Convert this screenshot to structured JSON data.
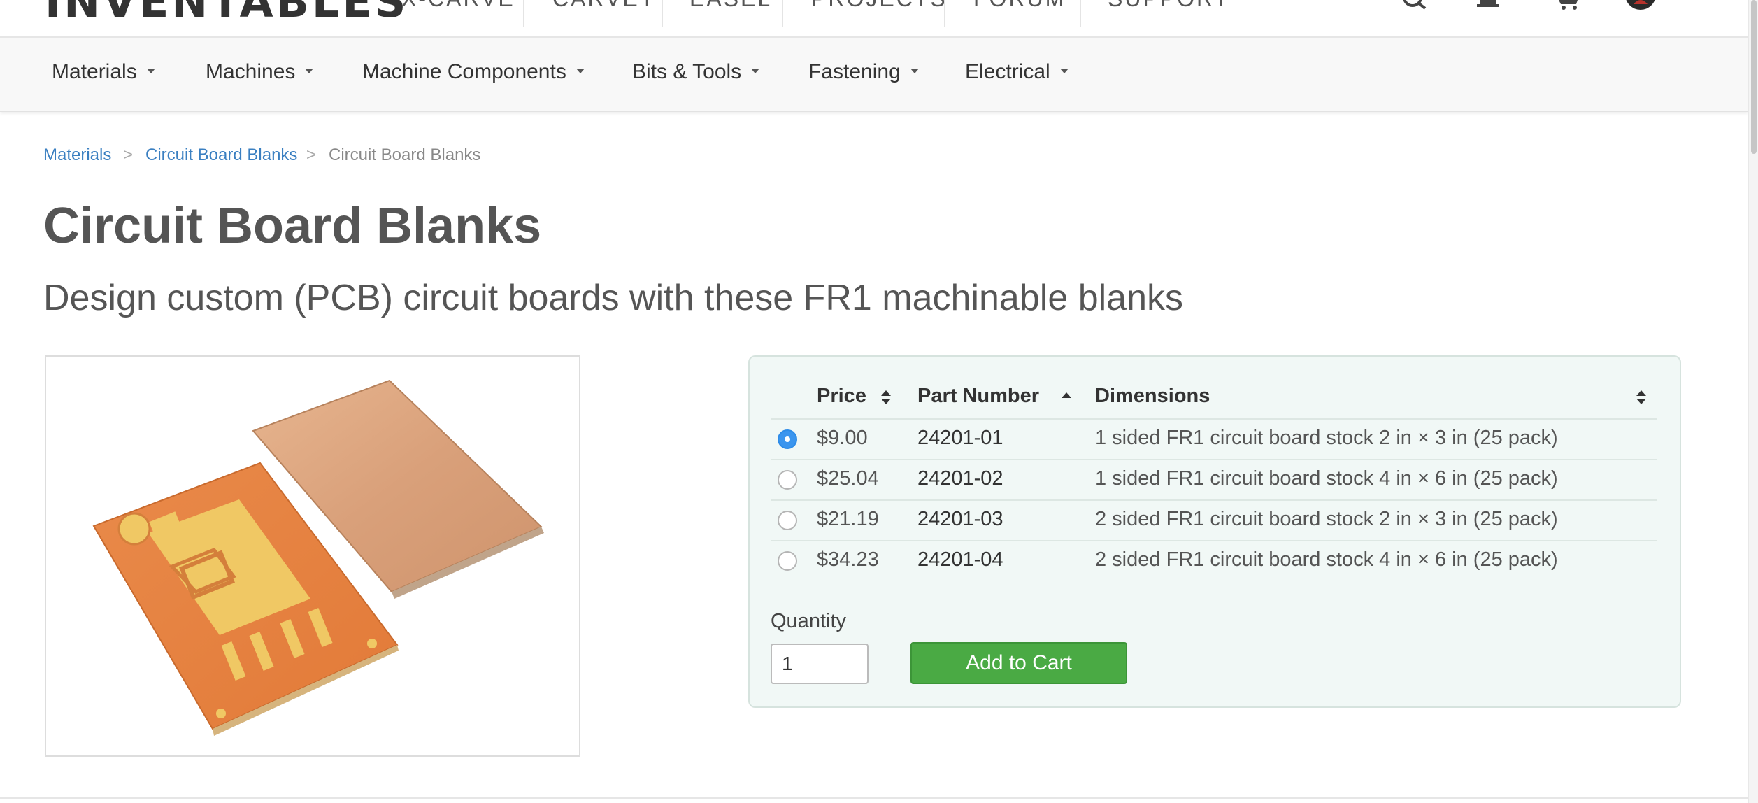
{
  "header": {
    "logo": "INVENTABLES",
    "nav": [
      "X-CARVE",
      "CARVEY",
      "EASEL",
      "PROJECTS",
      "FORUM",
      "SUPPORT"
    ],
    "icons": [
      "search-icon",
      "bell-icon",
      "cart-icon",
      "avatar"
    ]
  },
  "categories": [
    {
      "label": "Materials"
    },
    {
      "label": "Machines"
    },
    {
      "label": "Machine Components"
    },
    {
      "label": "Bits & Tools"
    },
    {
      "label": "Fastening"
    },
    {
      "label": "Electrical"
    }
  ],
  "breadcrumb": {
    "items": [
      "Materials",
      "Circuit Board Blanks",
      "Circuit Board Blanks"
    ],
    "separator": ">"
  },
  "page": {
    "title": "Circuit Board Blanks",
    "subtitle": "Design custom (PCB) circuit boards with these FR1 machinable blanks"
  },
  "table": {
    "headers": {
      "price": "Price",
      "part_number": "Part Number",
      "dimensions": "Dimensions"
    },
    "rows": [
      {
        "price": "$9.00",
        "part": "24201-01",
        "dim": "1 sided FR1 circuit board stock 2 in × 3 in (25 pack)",
        "selected": true
      },
      {
        "price": "$25.04",
        "part": "24201-02",
        "dim": "1 sided FR1 circuit board stock 4 in × 6 in (25 pack)",
        "selected": false
      },
      {
        "price": "$21.19",
        "part": "24201-03",
        "dim": "2 sided FR1 circuit board stock 2 in × 3 in (25 pack)",
        "selected": false
      },
      {
        "price": "$34.23",
        "part": "24201-04",
        "dim": "2 sided FR1 circuit board stock 4 in × 6 in (25 pack)",
        "selected": false
      }
    ]
  },
  "purchase": {
    "quantity_label": "Quantity",
    "quantity_value": "1",
    "add_to_cart": "Add to Cart"
  },
  "colors": {
    "link": "#3a7fc1",
    "button": "#4aaa44",
    "radio_selected": "#3b95ee",
    "panel_bg": "#f1f8f6"
  }
}
